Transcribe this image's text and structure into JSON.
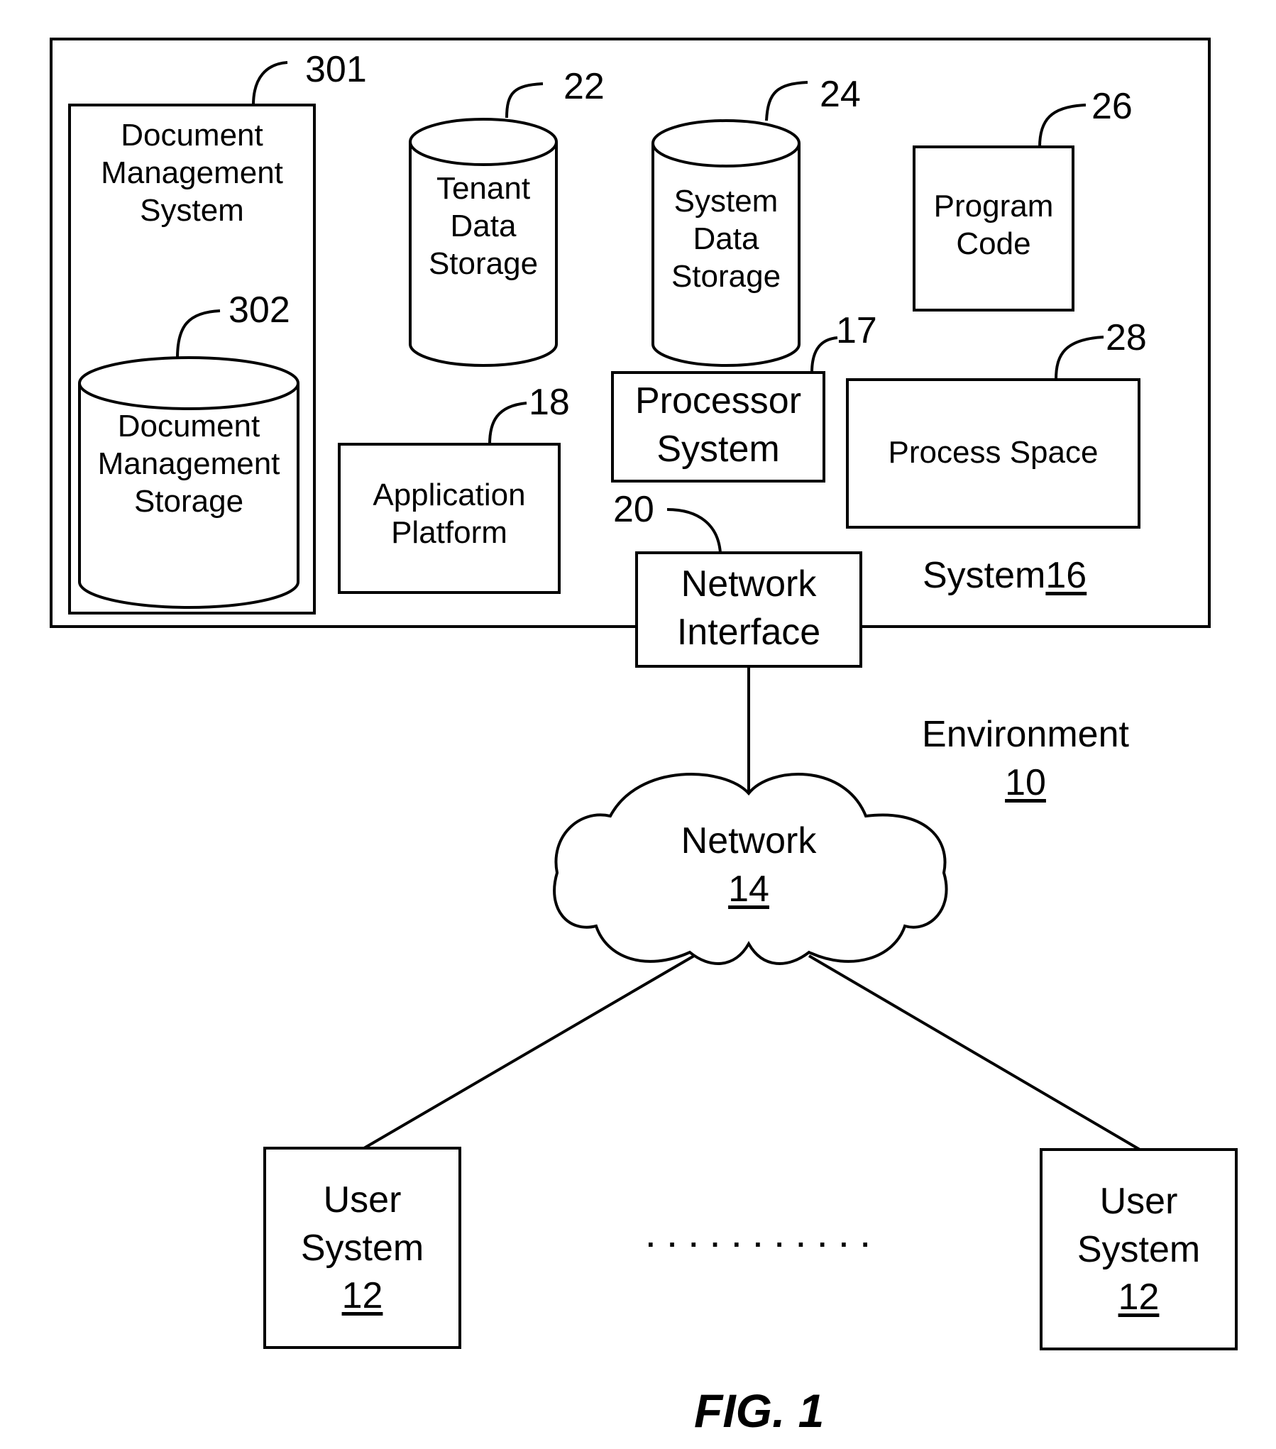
{
  "figure_label": "FIG. 1",
  "environment": {
    "label": "Environment",
    "ref": "10"
  },
  "system": {
    "label": "System",
    "ref": "16"
  },
  "components": {
    "document_management_system": {
      "lines": "Document\nManagement\nSystem",
      "ref": "301"
    },
    "document_management_storage": {
      "lines": "Document\nManagement\nStorage",
      "ref": "302"
    },
    "tenant_data_storage": {
      "lines": "Tenant\nData\nStorage",
      "ref": "22"
    },
    "system_data_storage": {
      "lines": "System\nData\nStorage",
      "ref": "24"
    },
    "program_code": {
      "lines": "Program\nCode",
      "ref": "26"
    },
    "processor_system": {
      "lines": "Processor\nSystem",
      "ref": "17"
    },
    "process_space": {
      "lines": "Process Space",
      "ref": "28"
    },
    "application_platform": {
      "lines": "Application\nPlatform",
      "ref": "18"
    },
    "network_interface": {
      "lines": "Network\nInterface",
      "ref": "20"
    }
  },
  "network": {
    "label": "Network",
    "ref": "14"
  },
  "user_systems": [
    {
      "label": "User\nSystem",
      "ref": "12"
    },
    {
      "label": "User\nSystem",
      "ref": "12"
    }
  ],
  "ellipsis": ". . . . . . . . . . ."
}
